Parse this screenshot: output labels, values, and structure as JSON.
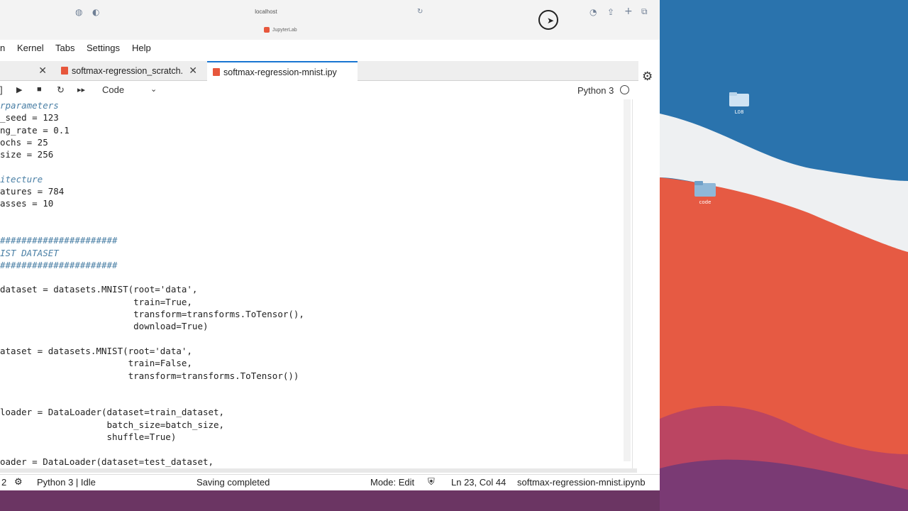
{
  "browser": {
    "url": "localhost",
    "page_tab_title": "JupyterLab"
  },
  "menu": {
    "items": [
      "n",
      "Kernel",
      "Tabs",
      "Settings",
      "Help"
    ]
  },
  "tabs": [
    {
      "label": ""
    },
    {
      "label": "softmax-regression_scratch."
    },
    {
      "label": "softmax-regression-mnist.ipy"
    }
  ],
  "toolbar": {
    "cell_type": "Code",
    "kernel": "Python 3"
  },
  "code_lines": [
    "rparameters",
    "_seed = 123",
    "ng_rate = 0.1",
    "ochs = 25",
    "size = 256",
    "",
    "itecture",
    "atures = 784",
    "asses = 10",
    "",
    "",
    "######################",
    "IST DATASET",
    "######################",
    "",
    "dataset = datasets.MNIST(root='data',",
    "                         train=True,",
    "                         transform=transforms.ToTensor(),",
    "                         download=True)",
    "",
    "ataset = datasets.MNIST(root='data',",
    "                        train=False,",
    "                        transform=transforms.ToTensor())",
    "",
    "",
    "loader = DataLoader(dataset=train_dataset,",
    "                    batch_size=batch_size,",
    "                    shuffle=True)",
    "",
    "oader = DataLoader(dataset=test_dataset,"
  ],
  "status": {
    "count": "2",
    "kernel": "Python 3 | Idle",
    "message": "Saving completed",
    "mode": "Mode: Edit",
    "position": "Ln 23, Col 44",
    "filename": "softmax-regression-mnist.ipynb"
  },
  "desktop": {
    "icons": [
      {
        "label": "L08"
      },
      {
        "label": "code"
      }
    ]
  },
  "colors": {
    "desktop_blue": "#2a73ad",
    "desktop_red": "#e65a43",
    "desktop_purple": "#6b3563",
    "notebook_icon": "#e7573c",
    "active_tab_border": "#1976d2"
  }
}
